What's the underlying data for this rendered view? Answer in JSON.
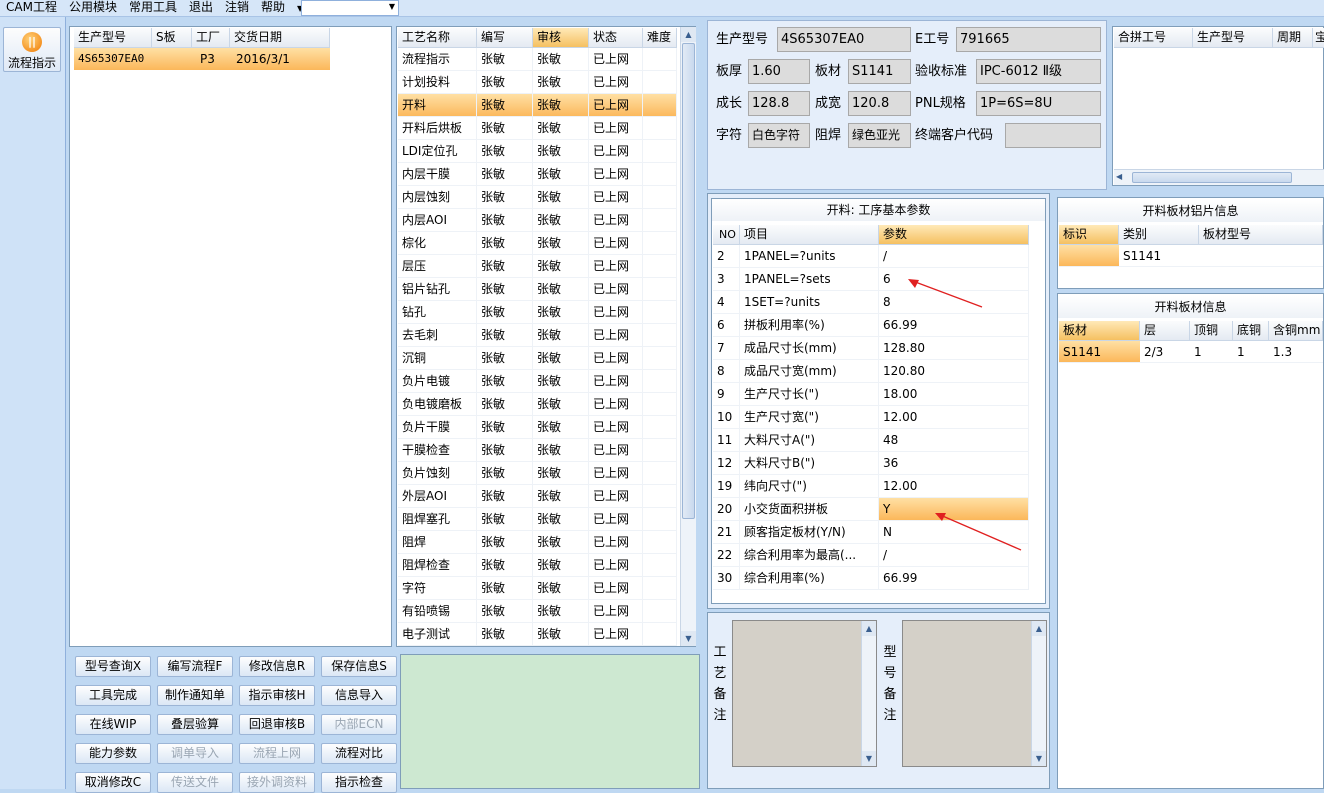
{
  "menu": {
    "items": [
      "CAM工程",
      "公用模块",
      "常用工具",
      "退出",
      "注销",
      "帮助"
    ],
    "combo_value": ""
  },
  "nav": {
    "flow_button_label": "流程指示",
    "flow_icon_glyph": "||"
  },
  "orders": {
    "headers": [
      "生产型号",
      "S板",
      "工厂",
      "交货日期"
    ],
    "rows": [
      {
        "model": "4S65307EA0",
        "sboard": "",
        "factory": "P3",
        "date": "2016/3/1"
      }
    ]
  },
  "process": {
    "headers": [
      "工艺名称",
      "编写",
      "审核",
      "状态",
      "难度"
    ],
    "selected_index": 2,
    "rows": [
      [
        "流程指示",
        "张敏",
        "张敏",
        "已上网"
      ],
      [
        "计划投料",
        "张敏",
        "张敏",
        "已上网"
      ],
      [
        "开料",
        "张敏",
        "张敏",
        "已上网"
      ],
      [
        "开料后烘板",
        "张敏",
        "张敏",
        "已上网"
      ],
      [
        "LDI定位孔",
        "张敏",
        "张敏",
        "已上网"
      ],
      [
        "内层干膜",
        "张敏",
        "张敏",
        "已上网"
      ],
      [
        "内层蚀刻",
        "张敏",
        "张敏",
        "已上网"
      ],
      [
        "内层AOI",
        "张敏",
        "张敏",
        "已上网"
      ],
      [
        "棕化",
        "张敏",
        "张敏",
        "已上网"
      ],
      [
        "层压",
        "张敏",
        "张敏",
        "已上网"
      ],
      [
        "铝片钻孔",
        "张敏",
        "张敏",
        "已上网"
      ],
      [
        "钻孔",
        "张敏",
        "张敏",
        "已上网"
      ],
      [
        "去毛刺",
        "张敏",
        "张敏",
        "已上网"
      ],
      [
        "沉铜",
        "张敏",
        "张敏",
        "已上网"
      ],
      [
        "负片电镀",
        "张敏",
        "张敏",
        "已上网"
      ],
      [
        "负电镀磨板",
        "张敏",
        "张敏",
        "已上网"
      ],
      [
        "负片干膜",
        "张敏",
        "张敏",
        "已上网"
      ],
      [
        "干膜检查",
        "张敏",
        "张敏",
        "已上网"
      ],
      [
        "负片蚀刻",
        "张敏",
        "张敏",
        "已上网"
      ],
      [
        "外层AOI",
        "张敏",
        "张敏",
        "已上网"
      ],
      [
        "阻焊塞孔",
        "张敏",
        "张敏",
        "已上网"
      ],
      [
        "阻焊",
        "张敏",
        "张敏",
        "已上网"
      ],
      [
        "阻焊检查",
        "张敏",
        "张敏",
        "已上网"
      ],
      [
        "字符",
        "张敏",
        "张敏",
        "已上网"
      ],
      [
        "有铅喷锡",
        "张敏",
        "张敏",
        "已上网"
      ],
      [
        "电子测试",
        "张敏",
        "张敏",
        "已上网"
      ]
    ]
  },
  "buttons": [
    [
      {
        "label": "型号查询X",
        "enabled": true
      },
      {
        "label": "编写流程F",
        "enabled": true
      },
      {
        "label": "修改信息R",
        "enabled": true
      },
      {
        "label": "保存信息S",
        "enabled": true
      }
    ],
    [
      {
        "label": "工具完成",
        "enabled": true
      },
      {
        "label": "制作通知单",
        "enabled": true
      },
      {
        "label": "指示审核H",
        "enabled": true
      },
      {
        "label": "信息导入",
        "enabled": true
      }
    ],
    [
      {
        "label": "在线WIP",
        "enabled": true
      },
      {
        "label": "叠层验算",
        "enabled": true
      },
      {
        "label": "回退审核B",
        "enabled": true
      },
      {
        "label": "内部ECN",
        "enabled": false
      }
    ],
    [
      {
        "label": "能力参数",
        "enabled": true
      },
      {
        "label": "调单导入",
        "enabled": false
      },
      {
        "label": "流程上网",
        "enabled": false
      },
      {
        "label": "流程对比",
        "enabled": true
      }
    ],
    [
      {
        "label": "取消修改C",
        "enabled": true
      },
      {
        "label": "传送文件",
        "enabled": false
      },
      {
        "label": "接外调资料",
        "enabled": false
      },
      {
        "label": "指示检查",
        "enabled": true
      }
    ]
  ],
  "info": {
    "model_label": "生产型号",
    "model_value": "4S65307EA0",
    "e_label": "E工号",
    "e_value": "791665",
    "thickness_label": "板厚",
    "thickness_value": "1.60",
    "material_label": "板材",
    "material_value": "S1141",
    "standard_label": "验收标准",
    "standard_value": "IPC-6012 Ⅱ级",
    "length_label": "成长",
    "length_value": "128.8",
    "width_label": "成宽",
    "width_value": "120.8",
    "pnl_label": "PNL规格",
    "pnl_value": "1P=6S=8U",
    "char_label": "字符",
    "char_value": "白色字符",
    "mask_label": "阻焊",
    "mask_value": "绿色亚光",
    "customer_label": "终端客户代码",
    "customer_value": ""
  },
  "merge": {
    "headers": [
      "合拼工号",
      "生产型号",
      "周期",
      "宝"
    ]
  },
  "params": {
    "title": "开料: 工序基本参数",
    "headers": [
      "NO",
      "项目",
      "参数"
    ],
    "rows": [
      [
        "2",
        "1PANEL=?units",
        "/"
      ],
      [
        "3",
        "1PANEL=?sets",
        "6"
      ],
      [
        "4",
        "1SET=?units",
        "8"
      ],
      [
        "6",
        "拼板利用率(%)",
        "66.99"
      ],
      [
        "7",
        "成品尺寸长(mm)",
        "128.80"
      ],
      [
        "8",
        "成品尺寸宽(mm)",
        "120.80"
      ],
      [
        "9",
        "生产尺寸长(\")",
        "18.00"
      ],
      [
        "10",
        "生产尺寸宽(\")",
        "12.00"
      ],
      [
        "11",
        "大料尺寸A(\")",
        "48"
      ],
      [
        "12",
        "大料尺寸B(\")",
        "36"
      ],
      [
        "19",
        "纬向尺寸(\")",
        "12.00"
      ],
      [
        "20",
        "小交货面积拼板",
        "Y"
      ],
      [
        "21",
        "顾客指定板材(Y/N)",
        "N"
      ],
      [
        "22",
        "综合利用率为最高(...",
        "/"
      ],
      [
        "30",
        "综合利用率(%)",
        "66.99"
      ]
    ],
    "highlight_index": 11
  },
  "alu": {
    "title": "开料板材铝片信息",
    "headers": [
      "标识",
      "类别",
      "板材型号"
    ],
    "row": [
      "",
      "S1141",
      ""
    ]
  },
  "cutting": {
    "title": "开料板材信息",
    "headers": [
      "板材",
      "层",
      "顶铜",
      "底铜",
      "含铜mm"
    ],
    "row": [
      "S1141",
      "2/3",
      "1",
      "1",
      "1.3"
    ]
  },
  "remarks": {
    "process_label": "工艺备注",
    "model_label": "型号备注"
  },
  "colors": {
    "accent": "#f5b452",
    "arrow": "#e02020",
    "window_bg": "#bfd8f2"
  }
}
